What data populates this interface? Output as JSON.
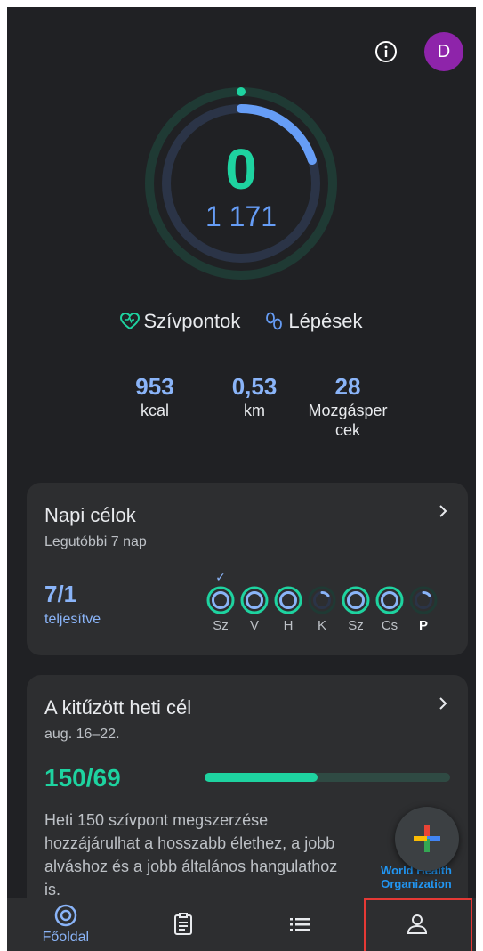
{
  "header": {
    "avatar_initial": "D",
    "info_icon": "info-icon"
  },
  "ring": {
    "heart_points": "0",
    "steps": "1 171",
    "heart_goal_fraction": 0.0,
    "steps_goal_fraction": 0.2,
    "colors": {
      "heart": "#1ed3a0",
      "steps": "#669df6"
    }
  },
  "legend": {
    "heart_label": "Szívpontok",
    "steps_label": "Lépések"
  },
  "stats": [
    {
      "value": "953",
      "label": "kcal"
    },
    {
      "value": "0,53",
      "label": "km"
    },
    {
      "value": "28",
      "label": "Mozgásper cek"
    }
  ],
  "daily_goals": {
    "title": "Napi célok",
    "subtitle": "Legutóbbi 7 nap",
    "count": "7/1",
    "status": "teljesítve",
    "days": [
      {
        "label": "Sz",
        "complete": true,
        "checked": true
      },
      {
        "label": "V",
        "complete": true,
        "checked": false
      },
      {
        "label": "H",
        "complete": true,
        "checked": false
      },
      {
        "label": "K",
        "complete": false,
        "checked": false
      },
      {
        "label": "Sz",
        "complete": true,
        "checked": false
      },
      {
        "label": "Cs",
        "complete": true,
        "checked": false
      },
      {
        "label": "P",
        "complete": false,
        "checked": false,
        "today": true
      }
    ]
  },
  "weekly_goal": {
    "title": "A kitűzött heti cél",
    "date_range": "aug. 16–22.",
    "count": "150/69",
    "progress_fraction": 0.46,
    "description": "Heti 150 szívpont megszerzése hozzájárulhat a hosszabb élethez, a jobb alváshoz és a jobb általános hangulathoz is.",
    "partner": "World Health Organization"
  },
  "nav": {
    "home_label": "Főoldal",
    "items": [
      "home-icon",
      "journal-icon",
      "browse-icon",
      "profile-icon"
    ]
  }
}
